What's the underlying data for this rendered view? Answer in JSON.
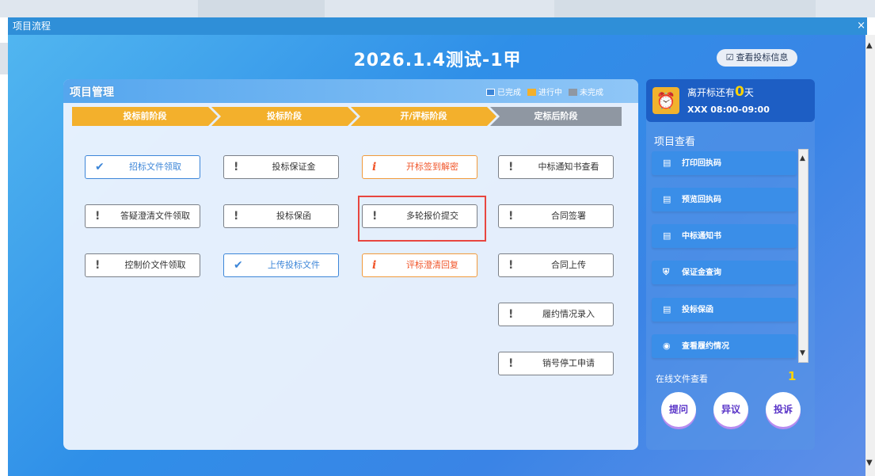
{
  "window": {
    "title": "项目流程",
    "close_glyph": "×"
  },
  "header": {
    "project_title": "2026.1.4测试-1甲",
    "info_button_label": "查看投标信息"
  },
  "panel": {
    "title": "项目管理",
    "legend": [
      {
        "label": "已完成",
        "color": "#3d86d8"
      },
      {
        "label": "进行中",
        "color": "#f3b02c"
      },
      {
        "label": "未完成",
        "color": "#8f97a2"
      }
    ],
    "stages": [
      {
        "label": "投标前阶段",
        "status": "in-progress",
        "color": "#f3b02c"
      },
      {
        "label": "投标阶段",
        "status": "in-progress",
        "color": "#f3b02c"
      },
      {
        "label": "开/评标阶段",
        "status": "in-progress",
        "color": "#f3b02c"
      },
      {
        "label": "定标后阶段",
        "status": "incomplete",
        "color": "#8f97a2"
      }
    ],
    "columns": [
      [
        {
          "label": "招标文件领取",
          "status": "done"
        },
        {
          "label": "答疑澄清文件领取",
          "status": "todo"
        },
        {
          "label": "控制价文件领取",
          "status": "todo"
        }
      ],
      [
        {
          "label": "投标保证金",
          "status": "todo"
        },
        {
          "label": "投标保函",
          "status": "todo"
        },
        {
          "label": "上传投标文件",
          "status": "done"
        }
      ],
      [
        {
          "label": "开标签到解密",
          "status": "progress"
        },
        {
          "label": "多轮报价提交",
          "status": "todo",
          "highlighted": true
        },
        {
          "label": "评标澄清回复",
          "status": "progress"
        }
      ],
      [
        {
          "label": "中标通知书查看",
          "status": "todo"
        },
        {
          "label": "合同签署",
          "status": "todo"
        },
        {
          "label": "合同上传",
          "status": "todo"
        },
        {
          "label": "履约情况录入",
          "status": "todo"
        },
        {
          "label": "销号停工申请",
          "status": "todo"
        }
      ]
    ]
  },
  "sidebar": {
    "timer": {
      "prefix": "离开标还有",
      "days": "0",
      "suffix": "天",
      "time": "XXX 08:00-09:00"
    },
    "title": "项目查看",
    "items": [
      {
        "label": "打印回执码",
        "icon": "document-icon"
      },
      {
        "label": "预览回执码",
        "icon": "document-icon"
      },
      {
        "label": "中标通知书",
        "icon": "document-icon"
      },
      {
        "label": "保证金查询",
        "icon": "shield-icon"
      },
      {
        "label": "投标保函",
        "icon": "document-icon"
      },
      {
        "label": "查看履约情况",
        "icon": "eye-icon"
      }
    ],
    "online_label": "在线文件查看",
    "online_count": "1",
    "actions": [
      "提问",
      "异议",
      "投诉"
    ]
  }
}
